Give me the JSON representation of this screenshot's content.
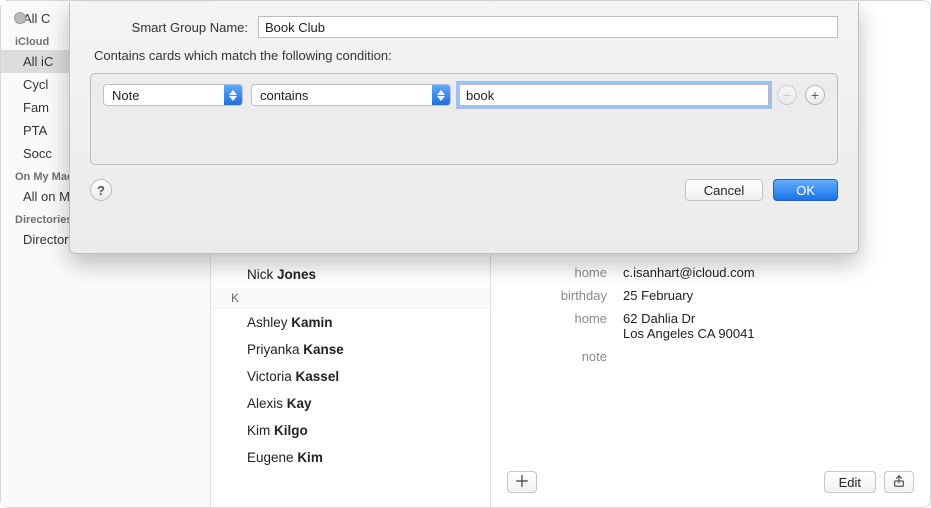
{
  "sidebar": {
    "top_item": "All C",
    "sections": [
      {
        "header": "iCloud",
        "items": [
          "All iC",
          "Cycl",
          "Fam",
          "PTA",
          "Socc"
        ],
        "selected_index": 0
      },
      {
        "header": "On My Mac",
        "items": [
          "All on My Mac"
        ]
      },
      {
        "header": "Directories",
        "items": [
          "Directory Services"
        ]
      }
    ]
  },
  "contacts": {
    "top_name": {
      "first": "Nick",
      "last": "Jones"
    },
    "section_letter": "K",
    "names": [
      {
        "first": "Ashley",
        "last": "Kamin"
      },
      {
        "first": "Priyanka",
        "last": "Kanse"
      },
      {
        "first": "Victoria",
        "last": "Kassel"
      },
      {
        "first": "Alexis",
        "last": "Kay"
      },
      {
        "first": "Kim",
        "last": "Kilgo"
      },
      {
        "first": "Eugene",
        "last": "Kim"
      }
    ]
  },
  "detail": {
    "rows": [
      {
        "label": "home",
        "value": "c.isanhart@icloud.com"
      },
      {
        "label": "birthday",
        "value": "25 February"
      },
      {
        "label": "home",
        "value": "62 Dahlia Dr\nLos Angeles CA 90041"
      },
      {
        "label": "note",
        "value": ""
      }
    ],
    "edit_label": "Edit"
  },
  "sheet": {
    "name_label": "Smart Group Name:",
    "name_value": "Book Club",
    "condition_desc": "Contains cards which match the following condition:",
    "rule": {
      "field": "Note",
      "operator": "contains",
      "value": "book"
    },
    "help_glyph": "?",
    "cancel_label": "Cancel",
    "ok_label": "OK"
  }
}
